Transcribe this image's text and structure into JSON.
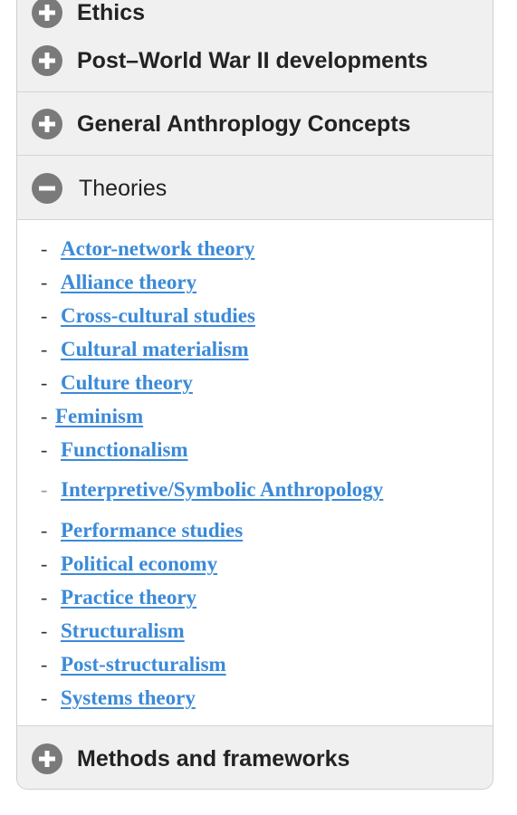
{
  "sections": [
    {
      "title": "Ethics",
      "expanded": false
    },
    {
      "title": "Post–World War II developments",
      "expanded": false
    },
    {
      "title": "General Anthroplogy Concepts",
      "expanded": false
    },
    {
      "title": "Theories",
      "expanded": true
    },
    {
      "title": "Methods and frameworks",
      "expanded": false
    }
  ],
  "theories": {
    "dash": "-",
    "items": [
      {
        "label": "Actor-network theory"
      },
      {
        "label": "Alliance theory"
      },
      {
        "label": "Cross-cultural studies"
      },
      {
        "label": "Cultural materialism"
      },
      {
        "label": "Culture theory"
      },
      {
        "label": "Feminism"
      },
      {
        "label": "Functionalism"
      },
      {
        "label": "Interpretive/Symbolic Anthropology"
      },
      {
        "label": "Performance studies"
      },
      {
        "label": "Political economy"
      },
      {
        "label": "Practice theory"
      },
      {
        "label": "Structuralism"
      },
      {
        "label": "Post-structuralism"
      },
      {
        "label": "Systems theory"
      }
    ]
  },
  "colors": {
    "link": "#3b8ad8",
    "icon": "#7a7a7a",
    "header_bg": "#f0f0f0"
  },
  "icons": {
    "collapsed": "plus-circle-icon",
    "expanded": "minus-circle-icon"
  }
}
